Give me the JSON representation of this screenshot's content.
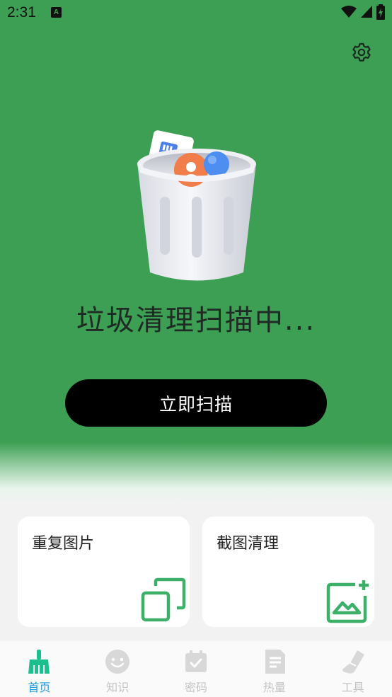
{
  "status_bar": {
    "time": "2:31",
    "notification_letter": "A",
    "icons": [
      "wifi-icon",
      "signal-icon",
      "battery-charging-icon"
    ]
  },
  "header": {
    "settings_icon": "gear-icon"
  },
  "hero": {
    "title": "垃圾清理扫描中...",
    "button_label": "立即扫描",
    "illustration": "trash-bin-icon"
  },
  "cards": [
    {
      "title": "重复图片",
      "icon": "duplicate-images-icon"
    },
    {
      "title": "截图清理",
      "icon": "add-image-icon"
    }
  ],
  "tabs": [
    {
      "label": "首页",
      "icon": "broom-icon",
      "active": true
    },
    {
      "label": "知识",
      "icon": "smile-icon",
      "active": false
    },
    {
      "label": "密码",
      "icon": "calendar-check-icon",
      "active": false
    },
    {
      "label": "热量",
      "icon": "document-icon",
      "active": false
    },
    {
      "label": "工具",
      "icon": "shoe-icon",
      "active": false
    }
  ],
  "colors": {
    "hero_green": "#3d9f53",
    "accent_green": "#3cb068",
    "active_tab": "#1d9bd6",
    "inactive_tab": "#c4c4c4"
  }
}
